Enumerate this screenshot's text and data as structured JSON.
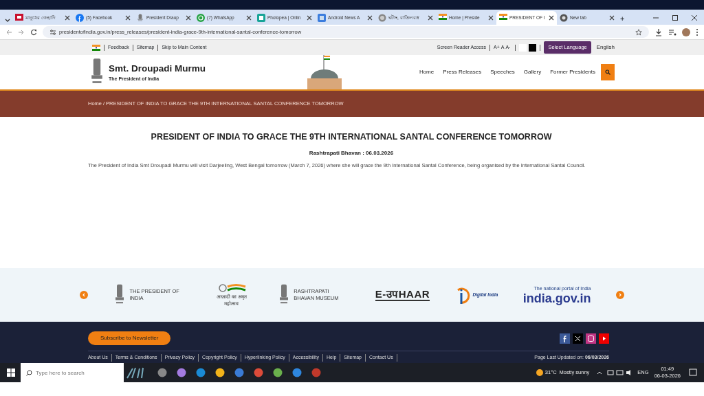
{
  "browser": {
    "tabs": [
      {
        "title": "মানুষের জেহাদি",
        "selected": false
      },
      {
        "title": "(5) Facebook",
        "selected": false
      },
      {
        "title": "President Draup",
        "selected": false
      },
      {
        "title": "(7) WhatsApp",
        "selected": false
      },
      {
        "title": "Photopea | Onlin",
        "selected": false
      },
      {
        "title": "Android News A",
        "selected": false
      },
      {
        "title": "ঘটাং, বাতিল বস্ত্র",
        "selected": false
      },
      {
        "title": "Home | Preside",
        "selected": false
      },
      {
        "title": "PRESIDENT OF I",
        "selected": true
      },
      {
        "title": "New tab",
        "selected": false
      }
    ],
    "new_tab": "+",
    "url": "presidentofindia.gov.in/press_releases/president-india-grace-9th-international-santal-conference-tomorrow"
  },
  "utility_bar": {
    "links": [
      "Feedback",
      "Sitemap",
      "Skip to Main Content"
    ],
    "screen_reader": "Screen Reader Access",
    "font_sizes": [
      "A+",
      "A",
      "A-"
    ],
    "select_language": "Select Language",
    "language": "English"
  },
  "header": {
    "title": "Smt. Droupadi Murmu",
    "subtitle": "The President of India",
    "nav": [
      "Home",
      "Press Releases",
      "Speeches",
      "Gallery",
      "Former Presidents"
    ]
  },
  "breadcrumb": {
    "separator": "/",
    "items": [
      "Home",
      "PRESIDENT OF INDIA TO GRACE THE 9TH INTERNATIONAL SANTAL CONFERENCE TOMORROW"
    ]
  },
  "article": {
    "title": "PRESIDENT OF INDIA TO GRACE THE 9TH INTERNATIONAL SANTAL CONFERENCE TOMORROW",
    "dateline": "Rashtrapati Bhavan : 06.03.2026",
    "body": "The President of India Smt Droupadi Murmu will visit Darjeeling, West Bengal tomorrow (March 7, 2026) where she will grace the 9th International Santal Conference, being organised by the International Santal Council."
  },
  "partners": [
    {
      "kind": "emblem",
      "text": "THE PRESIDENT OF INDIA"
    },
    {
      "kind": "azadi",
      "text": "आज़ादी का अमृत महोत्सव"
    },
    {
      "kind": "emblem",
      "text": "RASHTRAPATI BHAVAN MUSEUM"
    },
    {
      "kind": "wordmark",
      "text": "E-उपHAAR"
    },
    {
      "kind": "digital",
      "text": "Digital India"
    },
    {
      "kind": "portal",
      "text": "india.gov.in",
      "tagline": "The national portal of India"
    }
  ],
  "footer": {
    "subscribe": "Subscribe to Newsletter",
    "links": [
      "About Us",
      "Terms & Conditions",
      "Privacy Policy",
      "Copyright Policy",
      "Hyperlinking Policy",
      "Accessibility",
      "Help",
      "Sitemap",
      "Contact Us"
    ],
    "updated_label": "Page Last Updated on:",
    "updated_date": "06/03/2026"
  },
  "taskbar": {
    "search_placeholder": "Type here to search",
    "temperature": "31°C",
    "weather": "Mostly sunny",
    "language": "ENG",
    "time": "01:49",
    "date": "06-03-2026"
  }
}
